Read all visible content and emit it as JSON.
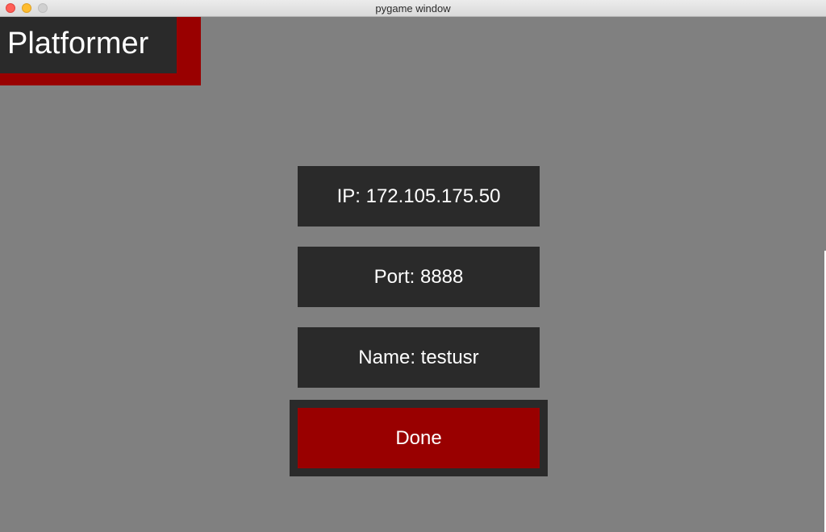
{
  "window": {
    "title": "pygame window"
  },
  "logo": {
    "text": "Platformer"
  },
  "fields": {
    "ip": "IP: 172.105.175.50",
    "port": "Port: 8888",
    "name": "Name: testusr"
  },
  "actions": {
    "done_label": "Done"
  },
  "colors": {
    "background": "#808080",
    "panel": "#2a2a2a",
    "accent_red": "#990000",
    "text": "#ffffff"
  }
}
